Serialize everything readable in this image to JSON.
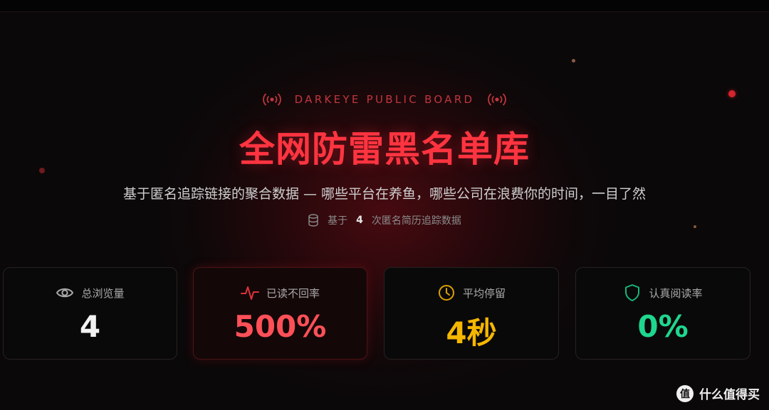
{
  "header": {
    "eyebrow": "DARKEYE PUBLIC BOARD",
    "title": "全网防雷黑名单库",
    "subtitle": "基于匿名追踪链接的聚合数据 — 哪些平台在养鱼，哪些公司在浪费你的时间，一目了然",
    "meta_prefix": "基于",
    "meta_count": "4",
    "meta_suffix": "次匿名简历追踪数据"
  },
  "stats": [
    {
      "label": "总浏览量",
      "value": "4",
      "icon": "eye-icon",
      "color": "#f2f2f2"
    },
    {
      "label": "已读不回率",
      "value": "500%",
      "icon": "pulse-icon",
      "color": "#ff5058"
    },
    {
      "label": "平均停留",
      "value": "4秒",
      "icon": "clock-icon",
      "color": "#f5b700"
    },
    {
      "label": "认真阅读率",
      "value": "0%",
      "icon": "shield-icon",
      "color": "#1fd68f"
    }
  ],
  "colors": {
    "accent_red": "#ff3440",
    "background": "#0b0809"
  },
  "watermark": {
    "logo_glyph": "值",
    "text": "什么值得买"
  }
}
